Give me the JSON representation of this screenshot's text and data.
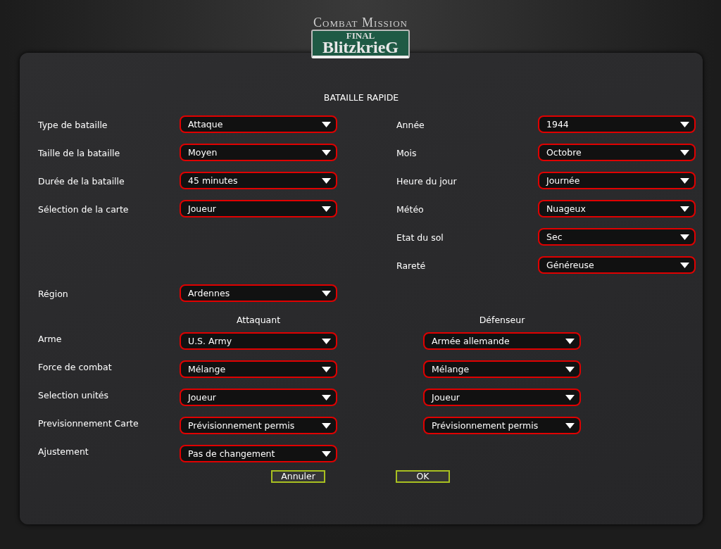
{
  "logo": {
    "top": "Combat Mission",
    "badge_top": "FINAL",
    "badge_main": "BlitzkrieG"
  },
  "title": "BATAILLE RAPIDE",
  "left_settings": [
    {
      "label": "Type de bataille",
      "value": "Attaque"
    },
    {
      "label": "Taille de la bataille",
      "value": "Moyen"
    },
    {
      "label": "Durée de la bataille",
      "value": "45 minutes"
    },
    {
      "label": "Sélection de la carte",
      "value": "Joueur"
    }
  ],
  "region": {
    "label": "Région",
    "value": "Ardennes"
  },
  "right_settings": [
    {
      "label": "Année",
      "value": "1944"
    },
    {
      "label": "Mois",
      "value": "Octobre"
    },
    {
      "label": "Heure du jour",
      "value": "Journée"
    },
    {
      "label": "Météo",
      "value": "Nuageux"
    },
    {
      "label": "Etat du sol",
      "value": "Sec"
    },
    {
      "label": "Rareté",
      "value": "Généreuse"
    }
  ],
  "forces": {
    "attacker_heading": "Attaquant",
    "defender_heading": "Défenseur",
    "rows": [
      {
        "label": "Arme",
        "attacker": "U.S. Army",
        "defender": "Armée allemande"
      },
      {
        "label": "Force de combat",
        "attacker": "Mélange",
        "defender": "Mélange"
      },
      {
        "label": "Selection unités",
        "attacker": "Joueur",
        "defender": "Joueur"
      },
      {
        "label": "Previsionnement Carte",
        "attacker": "Prévisionnement permis",
        "defender": "Prévisionnement permis"
      },
      {
        "label": "Ajustement",
        "attacker": "Pas de changement"
      }
    ]
  },
  "buttons": [
    "Annuler",
    "OK"
  ]
}
